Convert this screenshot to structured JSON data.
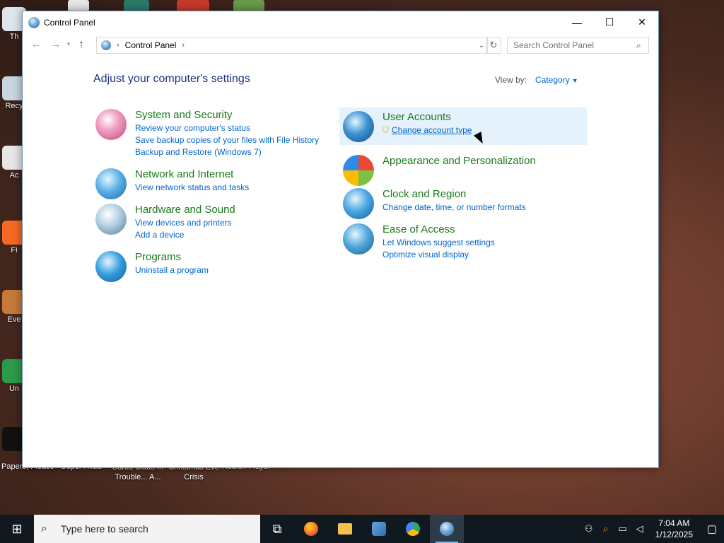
{
  "desktop": {
    "left_labels": [
      "Th",
      "Recy",
      "Ac",
      "Fi",
      "Eve",
      "Un"
    ],
    "bottom_labels": [
      "Papers, Please",
      "Super Hilda",
      "Santa Claus In Trouble... A...",
      "Christmas Eve Crisis",
      "Roblox Player"
    ]
  },
  "window": {
    "title": "Control Panel",
    "controls": {
      "minimize": "—",
      "maximize": "☐",
      "close": "✕"
    }
  },
  "nav": {
    "back": "←",
    "forward": "→",
    "up": "↑",
    "breadcrumb": [
      "Control Panel"
    ],
    "refresh": "↻",
    "search_placeholder": "Search Control Panel"
  },
  "content": {
    "heading": "Adjust your computer's settings",
    "view_by_label": "View by:",
    "view_by_value": "Category"
  },
  "categories_left": [
    {
      "title": "System and Security",
      "icon": "shield-icon",
      "links": [
        "Review your computer's status",
        "Save backup copies of your files with File History",
        "Backup and Restore (Windows 7)"
      ]
    },
    {
      "title": "Network and Internet",
      "icon": "globe-icon",
      "links": [
        "View network status and tasks"
      ]
    },
    {
      "title": "Hardware and Sound",
      "icon": "printer-icon",
      "links": [
        "View devices and printers",
        "Add a device"
      ]
    },
    {
      "title": "Programs",
      "icon": "programs-icon",
      "links": [
        "Uninstall a program"
      ]
    }
  ],
  "categories_right": [
    {
      "title": "User Accounts",
      "icon": "users-icon",
      "links": [
        "Change account type"
      ]
    },
    {
      "title": "Appearance and Personalization",
      "icon": "appearance-icon",
      "links": []
    },
    {
      "title": "Clock and Region",
      "icon": "clock-icon",
      "links": [
        "Change date, time, or number formats"
      ]
    },
    {
      "title": "Ease of Access",
      "icon": "ease-of-access-icon",
      "links": [
        "Let Windows suggest settings",
        "Optimize visual display"
      ]
    }
  ],
  "taskbar": {
    "search_text": "Type here to search",
    "time": "7:04 AM",
    "date": "1/12/2025",
    "apps": [
      "task-view-icon",
      "firefox-icon",
      "file-explorer-icon",
      "people-icon",
      "app-icon",
      "control-panel-icon"
    ]
  }
}
